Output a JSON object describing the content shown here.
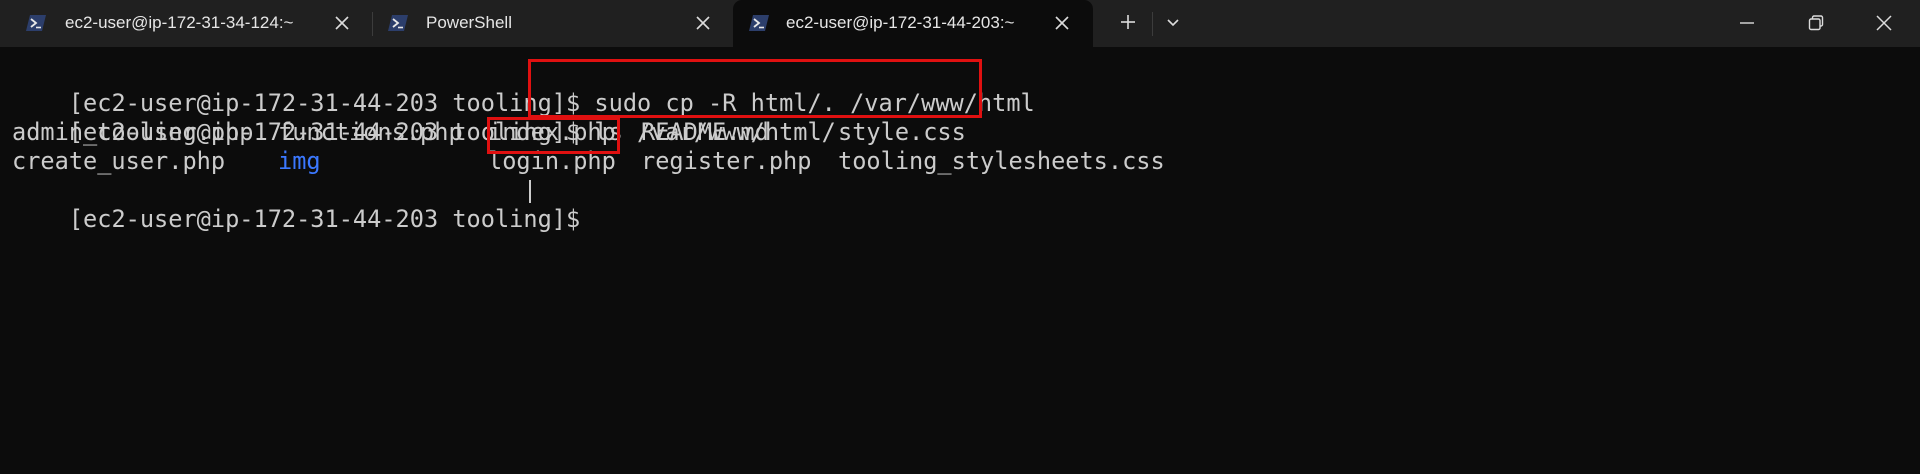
{
  "window": {
    "tabs": [
      {
        "title": "ec2-user@ip-172-31-34-124:~",
        "icon": "powershell-icon",
        "active": false
      },
      {
        "title": "PowerShell",
        "icon": "powershell-icon",
        "active": false
      },
      {
        "title": "ec2-user@ip-172-31-44-203:~",
        "icon": "powershell-icon",
        "active": true
      }
    ],
    "new_tab_icon": "plus-icon",
    "tab_menu_icon": "chevron-down-icon",
    "controls": [
      "minimize-icon",
      "restore-icon",
      "close-icon"
    ]
  },
  "terminal": {
    "prompt": "[ec2-user@ip-172-31-44-203 tooling]$ ",
    "lines": [
      {
        "command": "sudo cp -R html/. /var/www/html"
      },
      {
        "command": "ls /var/www/html/"
      }
    ],
    "listing": {
      "row1": [
        "admin_tooling.php",
        "functions.php",
        "index.php",
        "README.md",
        "style.css"
      ],
      "row2": [
        "create_user.php",
        "img",
        "login.php",
        "register.php",
        "tooling_stylesheets.css"
      ]
    },
    "final_prompt": "[ec2-user@ip-172-31-44-203 tooling]$ ",
    "colors": {
      "background": "#0c0c0c",
      "text": "#cccccc",
      "directory": "#3b78ff",
      "highlight": "#e01010"
    }
  }
}
